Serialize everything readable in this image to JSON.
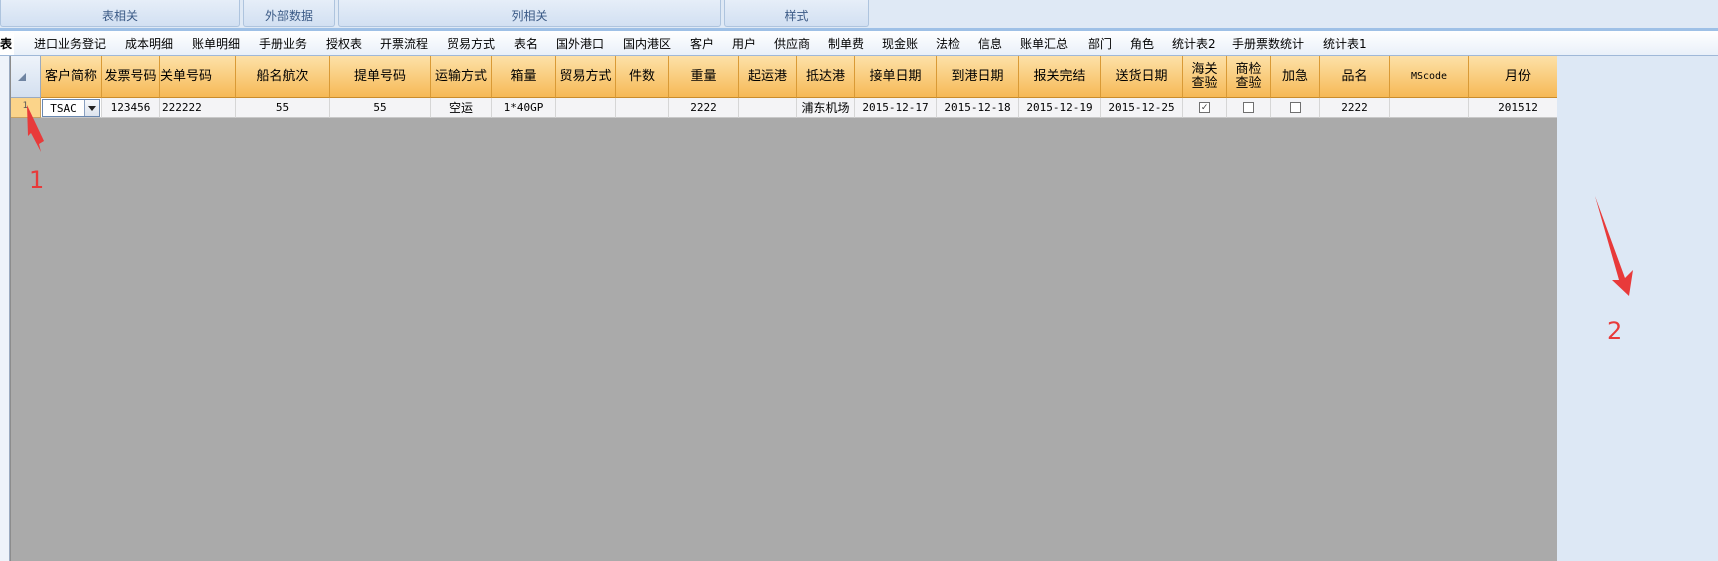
{
  "ribbon": {
    "groups": [
      {
        "label": "表相关"
      },
      {
        "label": "外部数据"
      },
      {
        "label": "列相关"
      },
      {
        "label": "样式"
      }
    ]
  },
  "tabs": [
    "费表",
    "进口业务登记",
    "成本明细",
    "账单明细",
    "手册业务",
    "授权表",
    "开票流程",
    "贸易方式",
    "表名",
    "国外港口",
    "国内港区",
    "客户",
    "用户",
    "供应商",
    "制单费",
    "现金账",
    "法检",
    "信息",
    "账单汇总",
    "部门",
    "角色",
    "统计表2",
    "手册票数统计",
    "统计表1"
  ],
  "grid": {
    "columns": [
      "客户简称",
      "发票号码",
      "关单号码",
      "船名航次",
      "提单号码",
      "运输方式",
      "箱量",
      "贸易方式",
      "件数",
      "重量",
      "起运港",
      "抵达港",
      "接单日期",
      "到港日期",
      "报关完结",
      "送货日期",
      "海关\n查验",
      "商检\n查验",
      "加急",
      "品名",
      "MScode",
      "月份"
    ],
    "rows": [
      {
        "row_number": "1",
        "values": [
          "TSAC",
          "123456",
          "222222",
          "55",
          "55",
          "空运",
          "1*40GP",
          "",
          "",
          "2222",
          "",
          "浦东机场",
          "2015-12-17",
          "2015-12-18",
          "2015-12-19",
          "2015-12-25",
          "",
          "",
          "",
          "2222",
          "",
          "201512"
        ],
        "checks": {
          "customs_inspection": true,
          "commodity_inspection": false,
          "urgent": false
        }
      }
    ]
  },
  "annotations": {
    "marker_1": "1",
    "marker_2": "2",
    "color": "#e83a3a"
  }
}
